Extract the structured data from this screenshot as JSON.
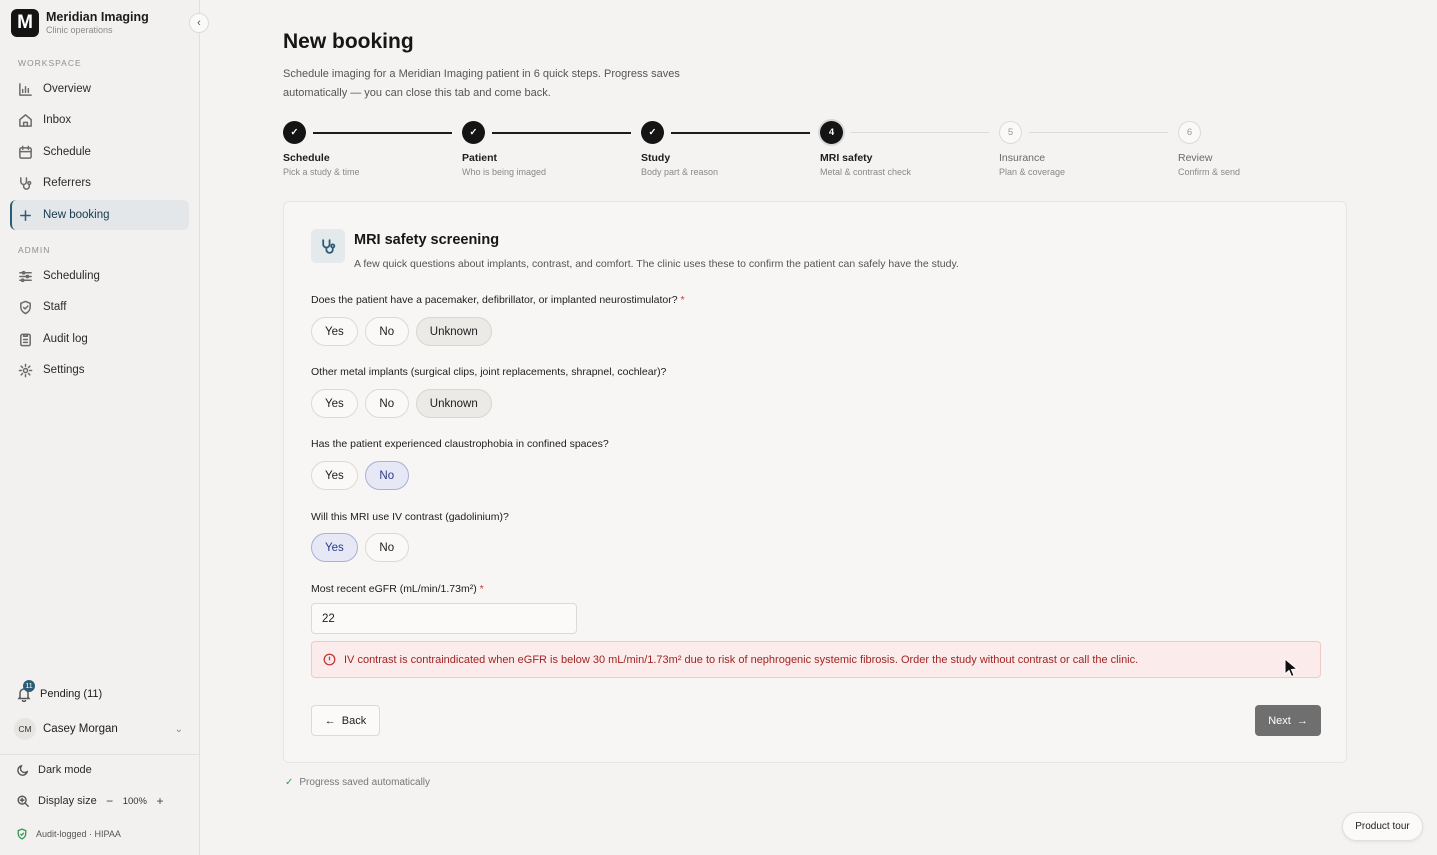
{
  "brand": {
    "logo_letter": "M",
    "name": "Meridian Imaging",
    "subtitle": "Clinic operations"
  },
  "sidebar": {
    "workspace_label": "WORKSPACE",
    "workspace_items": [
      {
        "label": "Overview",
        "icon": "chart-icon"
      },
      {
        "label": "Inbox",
        "icon": "home-icon"
      },
      {
        "label": "Schedule",
        "icon": "calendar-icon"
      },
      {
        "label": "Referrers",
        "icon": "stethoscope-icon"
      },
      {
        "label": "New booking",
        "icon": "plus-icon",
        "active": true
      }
    ],
    "admin_label": "ADMIN",
    "admin_items": [
      {
        "label": "Scheduling",
        "icon": "sliders-icon"
      },
      {
        "label": "Staff",
        "icon": "shield-icon"
      },
      {
        "label": "Audit log",
        "icon": "clipboard-icon"
      },
      {
        "label": "Settings",
        "icon": "gear-icon"
      }
    ],
    "pending": {
      "label": "Pending (11)",
      "badge": "11"
    },
    "user": {
      "initials": "CM",
      "name": "Casey Morgan"
    },
    "dark_mode_label": "Dark mode",
    "display_size": {
      "label": "Display size",
      "minus": "−",
      "value": "100%",
      "plus": "+"
    },
    "hipaa_label": "Audit-logged · HIPAA"
  },
  "page": {
    "title": "New booking",
    "subtitle": "Schedule imaging for a Meridian Imaging patient in 6 quick steps. Progress saves automatically — you can close this tab and come back."
  },
  "steps": [
    {
      "number": "1",
      "title": "Schedule",
      "desc": "Pick a study & time",
      "state": "done"
    },
    {
      "number": "2",
      "title": "Patient",
      "desc": "Who is being imaged",
      "state": "done"
    },
    {
      "number": "3",
      "title": "Study",
      "desc": "Body part & reason",
      "state": "done"
    },
    {
      "number": "4",
      "title": "MRI safety",
      "desc": "Metal & contrast check",
      "state": "current"
    },
    {
      "number": "5",
      "title": "Insurance",
      "desc": "Plan & coverage",
      "state": "future"
    },
    {
      "number": "6",
      "title": "Review",
      "desc": "Confirm & send",
      "state": "future"
    }
  ],
  "form": {
    "title": "MRI safety screening",
    "subtitle": "A few quick questions about implants, contrast, and comfort. The clinic uses these to confirm the patient can safely have the study.",
    "questions": [
      {
        "label": "Does the patient have a pacemaker, defibrillator, or implanted neurostimulator?",
        "required": "*",
        "options": [
          "Yes",
          "No",
          "Unknown"
        ],
        "selected": "Unknown"
      },
      {
        "label": "Other metal implants (surgical clips, joint replacements, shrapnel, cochlear)?",
        "required": "",
        "options": [
          "Yes",
          "No",
          "Unknown"
        ],
        "selected": "Unknown"
      },
      {
        "label": "Has the patient experienced claustrophobia in confined spaces?",
        "required": "",
        "options": [
          "Yes",
          "No"
        ],
        "selected": "No"
      },
      {
        "label": "Will this MRI use IV contrast (gadolinium)?",
        "required": "",
        "options": [
          "Yes",
          "No"
        ],
        "selected": "Yes"
      }
    ],
    "egfr_label": "Most recent eGFR (mL/min/1.73m²)",
    "egfr_required": "*",
    "egfr_value": "22",
    "alert": "IV contrast is contraindicated when eGFR is below 30 mL/min/1.73m² due to risk of nephrogenic systemic fibrosis. Order the study without contrast or call the clinic.",
    "back_label": "Back",
    "next_label": "Next"
  },
  "saved_label": "Progress saved automatically",
  "tour_label": "Product tour",
  "colors": {
    "accent": "#2c5d76",
    "selected_bg": "#e6e8f6",
    "alert_text": "#a02525",
    "alert_bg": "#fbeceb"
  }
}
